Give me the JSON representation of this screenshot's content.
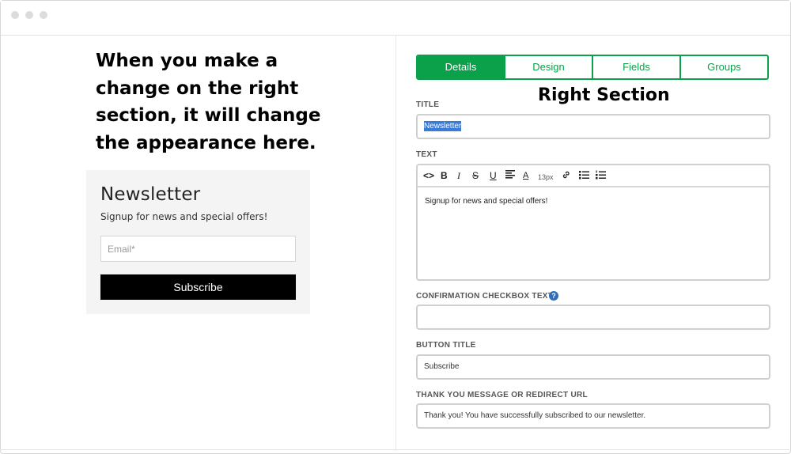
{
  "annotation": {
    "left_text": "When you make a change on the right section, it will change the appearance here.",
    "right_text": "Right Section"
  },
  "preview": {
    "title": "Newsletter",
    "text": "Signup for news and special offers!",
    "email_placeholder": "Email*",
    "subscribe_label": "Subscribe"
  },
  "tabs": [
    {
      "label": "Details",
      "active": true
    },
    {
      "label": "Design",
      "active": false
    },
    {
      "label": "Fields",
      "active": false
    },
    {
      "label": "Groups",
      "active": false
    }
  ],
  "form": {
    "title_label": "TITLE",
    "title_value": "Newsletter",
    "text_label": "TEXT",
    "text_value": "Signup for news and special offers!",
    "font_size": "13px",
    "confirmation_label": "CONFIRMATION CHECKBOX TEXT",
    "confirmation_value": "",
    "button_title_label": "BUTTON TITLE",
    "button_title_value": "Subscribe",
    "thankyou_label": "THANK YOU MESSAGE OR REDIRECT URL",
    "thankyou_value": "Thank you! You have successfully subscribed to our newsletter."
  },
  "toolbar_icons": [
    "code-icon",
    "bold-icon",
    "italic-icon",
    "strikethrough-icon",
    "underline-icon",
    "align-icon",
    "text-color-icon",
    "font-size-control",
    "link-icon",
    "bullet-list-icon",
    "numbered-list-icon"
  ],
  "colors": {
    "accent": "#0aa14a",
    "selection": "#3a7bd5",
    "button": "#000000"
  }
}
